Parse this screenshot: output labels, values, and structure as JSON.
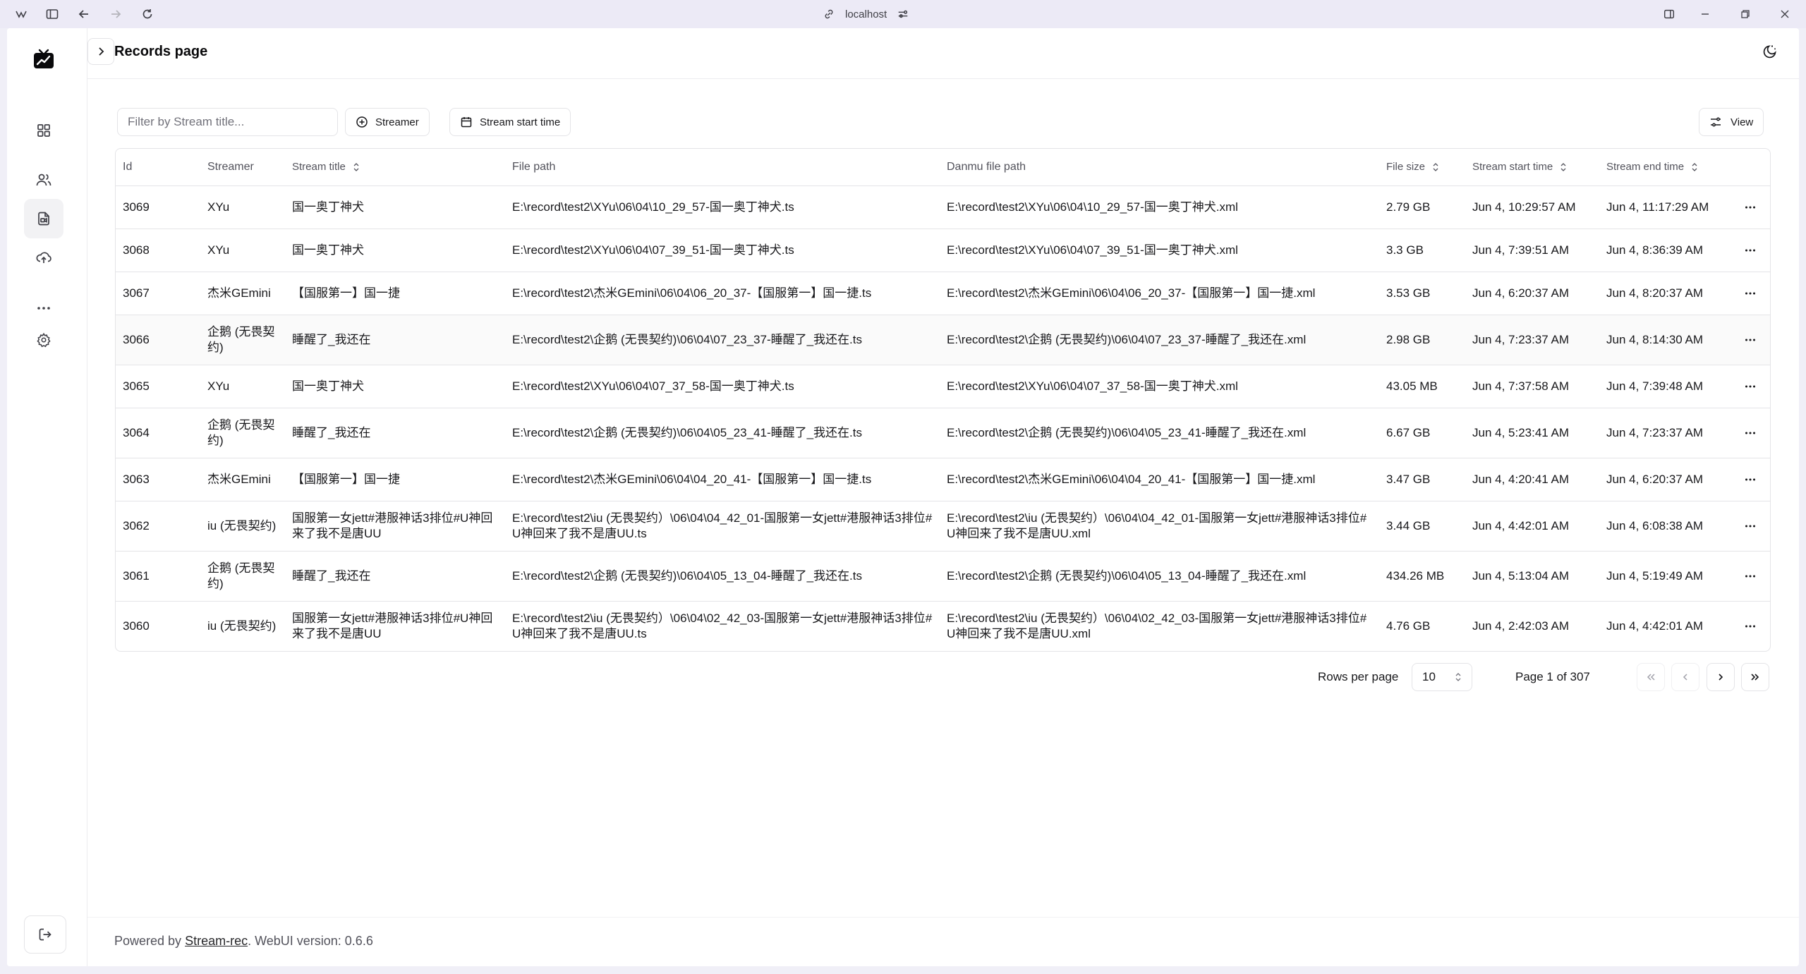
{
  "browser": {
    "address": "localhost"
  },
  "header": {
    "title": "Records page"
  },
  "toolbar": {
    "filter_placeholder": "Filter by Stream title...",
    "streamer_label": "Streamer",
    "start_time_label": "Stream start time",
    "view_label": "View"
  },
  "table": {
    "columns": {
      "id": "Id",
      "streamer": "Streamer",
      "title": "Stream title",
      "file_path": "File path",
      "danmu": "Danmu file path",
      "size": "File size",
      "start": "Stream start time",
      "end": "Stream end time"
    },
    "rows": [
      {
        "id": "3069",
        "streamer": "XYu",
        "title": "国一奥丁神犬",
        "file": "E:\\record\\test2\\XYu\\06\\04\\10_29_57-国一奥丁神犬.ts",
        "danmu": "E:\\record\\test2\\XYu\\06\\04\\10_29_57-国一奥丁神犬.xml",
        "size": "2.79 GB",
        "start": "Jun 4, 10:29:57 AM",
        "end": "Jun 4, 11:17:29 AM"
      },
      {
        "id": "3068",
        "streamer": "XYu",
        "title": "国一奥丁神犬",
        "file": "E:\\record\\test2\\XYu\\06\\04\\07_39_51-国一奥丁神犬.ts",
        "danmu": "E:\\record\\test2\\XYu\\06\\04\\07_39_51-国一奥丁神犬.xml",
        "size": "3.3 GB",
        "start": "Jun 4, 7:39:51 AM",
        "end": "Jun 4, 8:36:39 AM"
      },
      {
        "id": "3067",
        "streamer": "杰米GEmini",
        "title": "【国服第一】国一捷",
        "file": "E:\\record\\test2\\杰米GEmini\\06\\04\\06_20_37-【国服第一】国一捷.ts",
        "danmu": "E:\\record\\test2\\杰米GEmini\\06\\04\\06_20_37-【国服第一】国一捷.xml",
        "size": "3.53 GB",
        "start": "Jun 4, 6:20:37 AM",
        "end": "Jun 4, 8:20:37 AM"
      },
      {
        "id": "3066",
        "streamer": "企鹅 (无畏契约)",
        "title": "睡醒了_我还在",
        "file": "E:\\record\\test2\\企鹅 (无畏契约)\\06\\04\\07_23_37-睡醒了_我还在.ts",
        "danmu": "E:\\record\\test2\\企鹅 (无畏契约)\\06\\04\\07_23_37-睡醒了_我还在.xml",
        "size": "2.98 GB",
        "start": "Jun 4, 7:23:37 AM",
        "end": "Jun 4, 8:14:30 AM"
      },
      {
        "id": "3065",
        "streamer": "XYu",
        "title": "国一奥丁神犬",
        "file": "E:\\record\\test2\\XYu\\06\\04\\07_37_58-国一奥丁神犬.ts",
        "danmu": "E:\\record\\test2\\XYu\\06\\04\\07_37_58-国一奥丁神犬.xml",
        "size": "43.05 MB",
        "start": "Jun 4, 7:37:58 AM",
        "end": "Jun 4, 7:39:48 AM"
      },
      {
        "id": "3064",
        "streamer": "企鹅 (无畏契约)",
        "title": "睡醒了_我还在",
        "file": "E:\\record\\test2\\企鹅 (无畏契约)\\06\\04\\05_23_41-睡醒了_我还在.ts",
        "danmu": "E:\\record\\test2\\企鹅 (无畏契约)\\06\\04\\05_23_41-睡醒了_我还在.xml",
        "size": "6.67 GB",
        "start": "Jun 4, 5:23:41 AM",
        "end": "Jun 4, 7:23:37 AM"
      },
      {
        "id": "3063",
        "streamer": "杰米GEmini",
        "title": "【国服第一】国一捷",
        "file": "E:\\record\\test2\\杰米GEmini\\06\\04\\04_20_41-【国服第一】国一捷.ts",
        "danmu": "E:\\record\\test2\\杰米GEmini\\06\\04\\04_20_41-【国服第一】国一捷.xml",
        "size": "3.47 GB",
        "start": "Jun 4, 4:20:41 AM",
        "end": "Jun 4, 6:20:37 AM"
      },
      {
        "id": "3062",
        "streamer": "iu (无畏契约)",
        "title": "国服第一女jett#港服神话3排位#U神回来了我不是唐UU",
        "file": "E:\\record\\test2\\iu (无畏契约）\\06\\04\\04_42_01-国服第一女jett#港服神话3排位#U神回来了我不是唐UU.ts",
        "danmu": "E:\\record\\test2\\iu (无畏契约）\\06\\04\\04_42_01-国服第一女jett#港服神话3排位#U神回来了我不是唐UU.xml",
        "size": "3.44 GB",
        "start": "Jun 4, 4:42:01 AM",
        "end": "Jun 4, 6:08:38 AM"
      },
      {
        "id": "3061",
        "streamer": "企鹅 (无畏契约)",
        "title": "睡醒了_我还在",
        "file": "E:\\record\\test2\\企鹅 (无畏契约)\\06\\04\\05_13_04-睡醒了_我还在.ts",
        "danmu": "E:\\record\\test2\\企鹅 (无畏契约)\\06\\04\\05_13_04-睡醒了_我还在.xml",
        "size": "434.26 MB",
        "start": "Jun 4, 5:13:04 AM",
        "end": "Jun 4, 5:19:49 AM"
      },
      {
        "id": "3060",
        "streamer": "iu (无畏契约)",
        "title": "国服第一女jett#港服神话3排位#U神回来了我不是唐UU",
        "file": "E:\\record\\test2\\iu (无畏契约）\\06\\04\\02_42_03-国服第一女jett#港服神话3排位#U神回来了我不是唐UU.ts",
        "danmu": "E:\\record\\test2\\iu (无畏契约）\\06\\04\\02_42_03-国服第一女jett#港服神话3排位#U神回来了我不是唐UU.xml",
        "size": "4.76 GB",
        "start": "Jun 4, 2:42:03 AM",
        "end": "Jun 4, 4:42:01 AM"
      }
    ]
  },
  "pagination": {
    "rows_per_page_label": "Rows per page",
    "rows_per_page": "10",
    "page_label": "Page 1 of 307"
  },
  "footer": {
    "powered_by": "Powered by ",
    "link_text": "Stream-rec",
    "version": ". WebUI version: 0.6.6"
  }
}
